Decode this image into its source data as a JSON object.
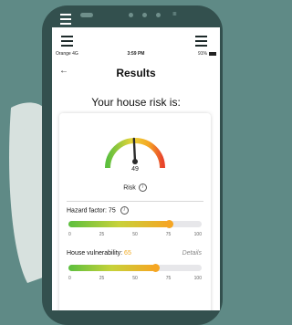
{
  "status_bar": {
    "carrier": "Orange 4G",
    "time": "3:59 PM",
    "battery": "91%"
  },
  "header": {
    "title": "Results"
  },
  "subtitle": "Your house risk is:",
  "gauge": {
    "value": "49",
    "label": "Risk",
    "fraction": 0.49
  },
  "hazard": {
    "label": "Hazard factor:",
    "value": "75",
    "fill_percent": 75,
    "ticks": [
      "0",
      "25",
      "50",
      "75",
      "100"
    ]
  },
  "vulnerability": {
    "label": "House vulnerability:",
    "value": "65",
    "details_label": "Details",
    "fill_percent": 65,
    "ticks": [
      "0",
      "25",
      "50",
      "75",
      "100"
    ]
  },
  "colors": {
    "background": "#5f8a86",
    "phone": "#33504e",
    "gauge_low": "#5cbf3e",
    "gauge_high": "#e8452c",
    "accent_orange": "#f5a623"
  }
}
